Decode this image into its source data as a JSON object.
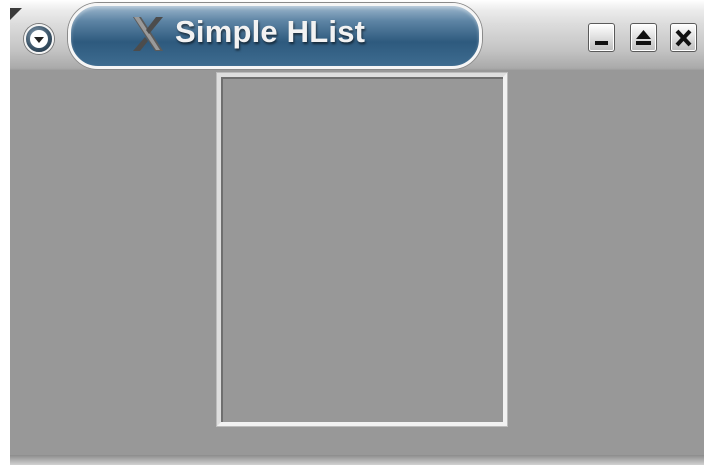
{
  "window": {
    "title": "Simple HList",
    "menu_icon": "chevron-down-circle-icon",
    "app_icon": "x-logo-icon"
  },
  "controls": {
    "minimize_icon": "minimize-icon",
    "maximize_icon": "maximize-icon",
    "close_icon": "close-icon"
  },
  "hlist": {
    "items": []
  },
  "colors": {
    "window_bg": "#989898",
    "title_pill": "#2e5a7e",
    "title_text": "#f2f2f2"
  }
}
